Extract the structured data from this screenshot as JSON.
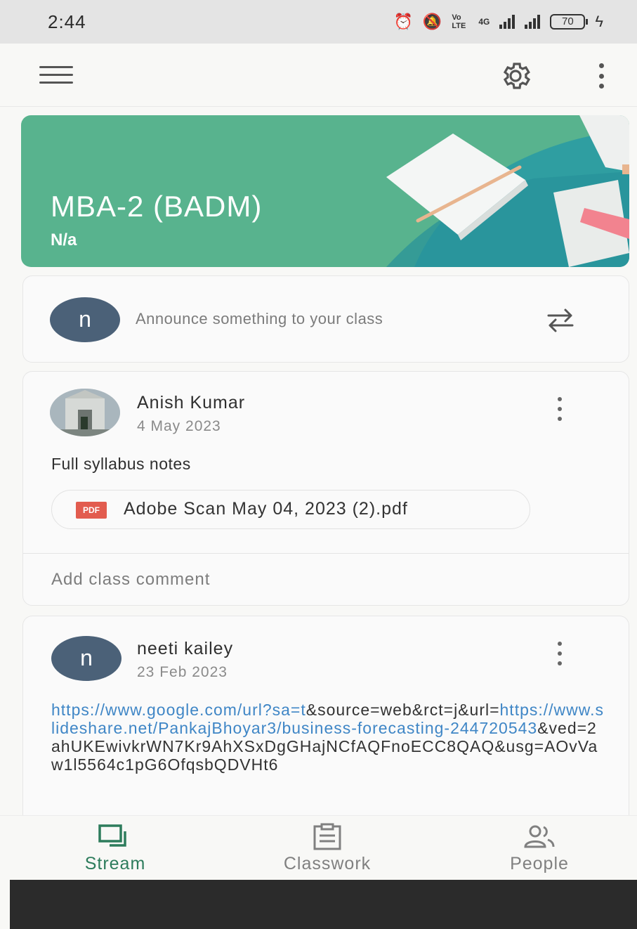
{
  "status_bar": {
    "time": "2:44",
    "network_label": "4G",
    "volte_label": "Vo LTE",
    "battery": "70"
  },
  "app_bar": {
    "menu_icon": "hamburger-icon",
    "settings_icon": "gear-icon",
    "more_icon": "kebab-icon"
  },
  "class": {
    "title": "MBA-2 (BADM)",
    "section": "N/a",
    "banner_color": "#58b38e"
  },
  "announce": {
    "avatar_letter": "n",
    "placeholder": "Announce something to your class"
  },
  "posts": [
    {
      "author": "Anish Kumar",
      "date": "4 May 2023",
      "body": "Full syllabus notes",
      "attachment": {
        "type_badge": "PDF",
        "name": "Adobe Scan May 04, 2023 (2).pdf"
      },
      "comment_placeholder": "Add class comment"
    },
    {
      "author": "neeti kailey",
      "avatar_letter": "n",
      "date": "23 Feb 2023",
      "link_parts": [
        {
          "text": "https://www.google.com/url?sa=t",
          "link": true
        },
        {
          "text": "&source=web&rct=j&url=",
          "link": false
        },
        {
          "text": "https://www.slideshare.net/PankajBhoyar3/business-forecasting-244720543",
          "link": true
        },
        {
          "text": "&ved=2ahUKEwivkrWN7Kr9AhXSxDgGHajNCfAQFnoECC8QAQ&usg=AOvVaw1l5564c1pG6OfqsbQDVHt6",
          "link": false
        }
      ]
    }
  ],
  "bottom_nav": {
    "stream": "Stream",
    "classwork": "Classwork",
    "people": "People",
    "active_color": "#2d7c5c"
  }
}
